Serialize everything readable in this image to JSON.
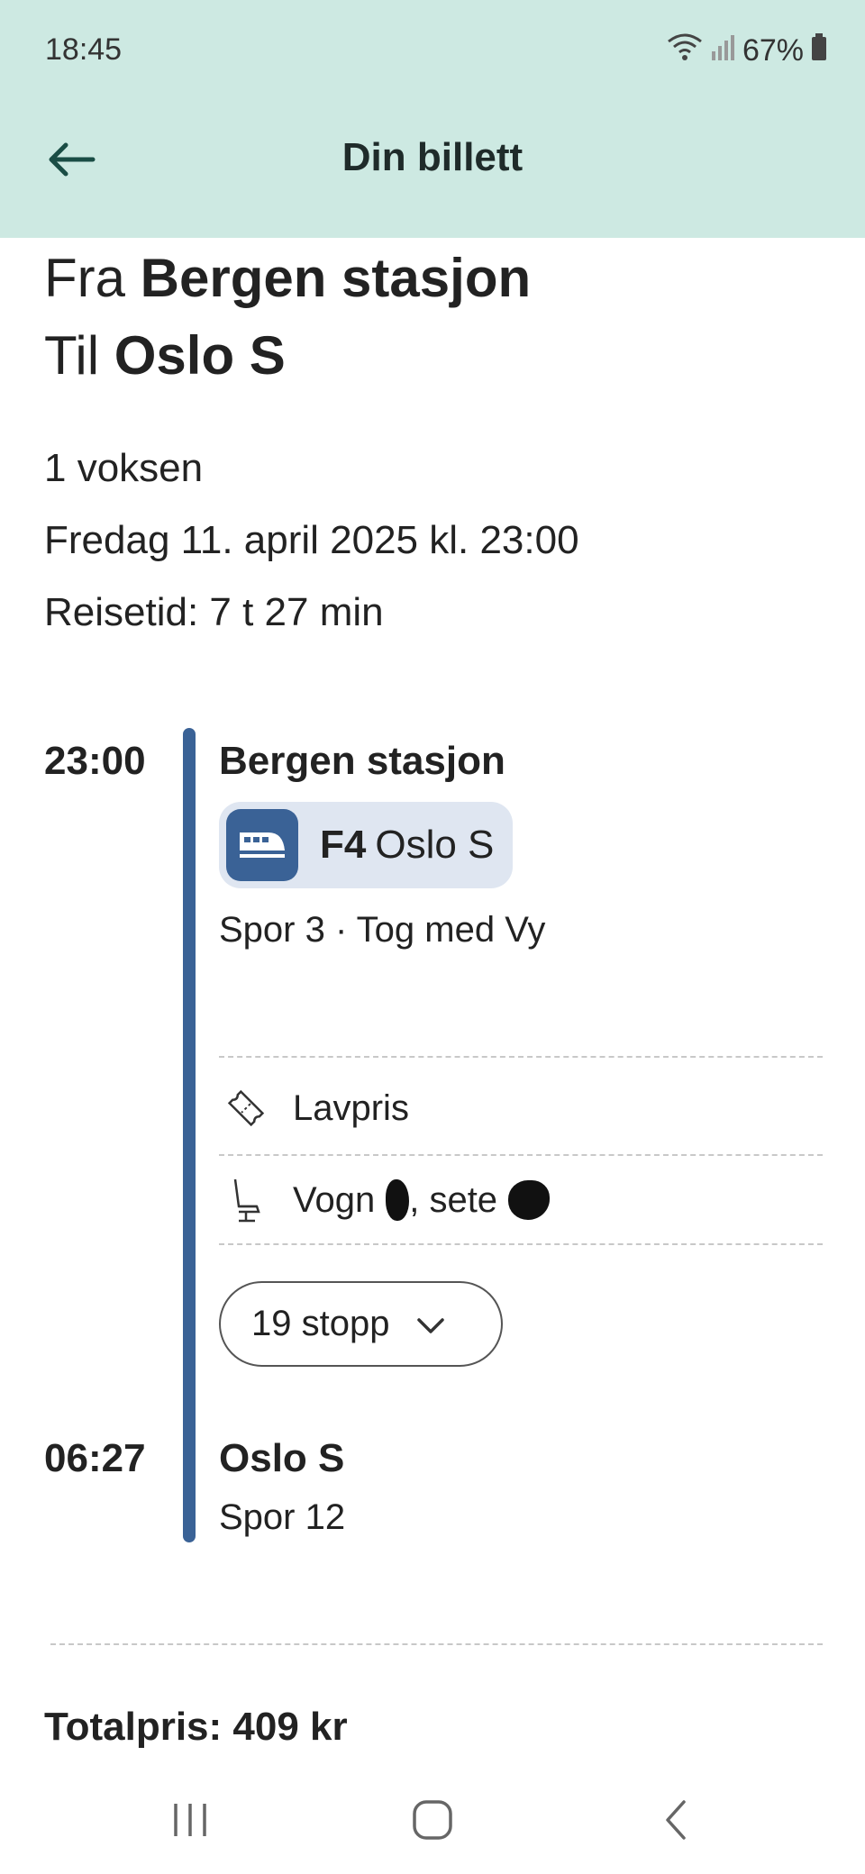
{
  "status_bar": {
    "time": "18:45",
    "battery": "67%",
    "icons": [
      "wifi-icon",
      "signal-icon",
      "battery-icon"
    ]
  },
  "app_bar": {
    "title": "Din billett",
    "back_icon": "arrow-left-icon"
  },
  "route": {
    "from_prefix": "Fra",
    "from": "Bergen stasjon",
    "to_prefix": "Til",
    "to": "Oslo S"
  },
  "trip": {
    "passengers": "1 voksen",
    "date": "Fredag 11. april 2025 kl. 23:00",
    "duration": "Reisetid: 7 t 27 min"
  },
  "departure": {
    "time": "23:00",
    "station": "Bergen stasjon",
    "line_code": "F4",
    "line_destination": "Oslo S",
    "platform_operator": "Spor 3 · Tog med Vy"
  },
  "ticket_info": {
    "fare": "Lavpris",
    "seat_prefix": "Vogn",
    "seat_middle": ", sete"
  },
  "stops_button": {
    "label": "19 stopp"
  },
  "arrival": {
    "time": "06:27",
    "station": "Oslo S",
    "platform": "Spor 12"
  },
  "total": {
    "label": "Totalpris: 409 kr"
  },
  "colors": {
    "header_bg": "#cde9e2",
    "accent": "#3a6296",
    "chip_bg": "#dfe6f1"
  }
}
